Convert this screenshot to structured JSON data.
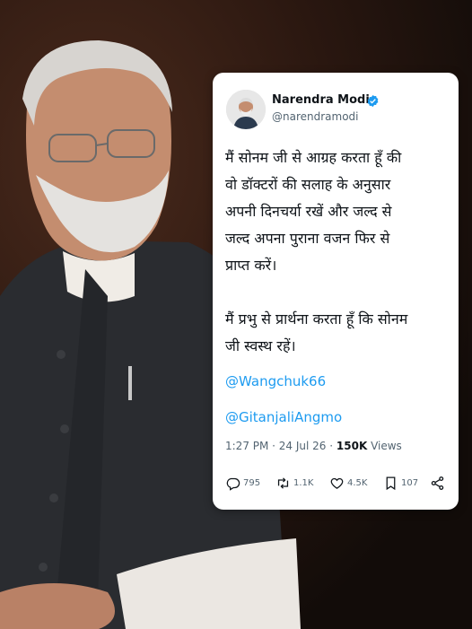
{
  "tweet": {
    "author_name": "Narendra Modi",
    "handle": "@narendramodi",
    "verified": true,
    "text": "मैं सोनम जी से आग्रह करता हूँ की\nवो डॉक्टरों की सलाह के अनुसार\nअपनी दिनचर्या रखें और जल्द से\nजल्द अपना पुराना वजन फिर से\nप्राप्त करें।\n\nमैं प्रभु से प्रार्थना करता हूँ कि सोनम\nजी स्वस्थ रहें।",
    "mentions": [
      "@Wangchuk66",
      "@GitanjaliAngmo"
    ],
    "time": "1:27 PM · 24 Jul 26 · ",
    "views_count": "150K",
    "views_label": " Views",
    "replies": "795",
    "retweets": "1.1K",
    "likes": "4.5K",
    "bookmarks": "107",
    "icons": [
      "reply-icon",
      "retweet-icon",
      "like-icon",
      "bookmark-icon",
      "share-icon",
      "verified-badge-icon"
    ]
  },
  "colors": {
    "link": "#1d9bf0",
    "verified": "#1d9bf0",
    "secondary_text": "#536471",
    "primary_text": "#0f1419"
  }
}
